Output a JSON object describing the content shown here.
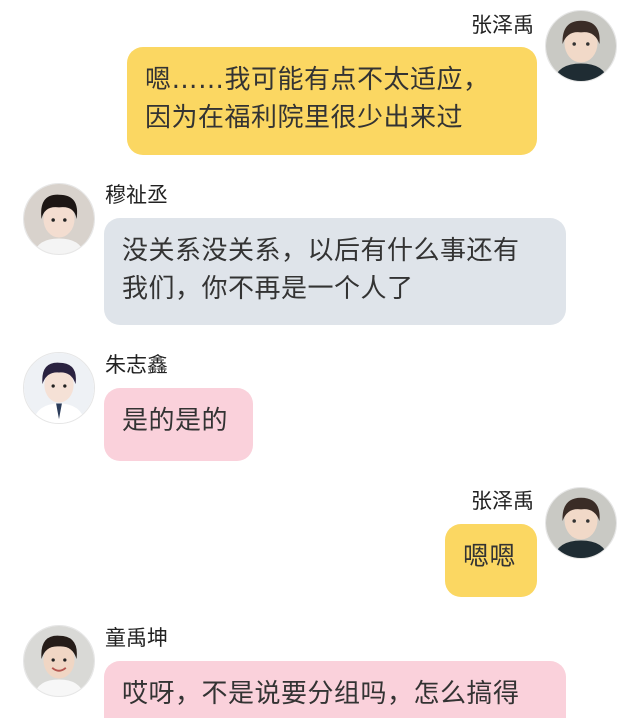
{
  "colors": {
    "self_bubble": "#fbd762",
    "grey_bubble": "#dfe4ea",
    "pink_bubble": "#fad1db",
    "name_text": "#222222",
    "message_text": "#333333"
  },
  "messages": [
    {
      "sender": "张泽禹",
      "side": "right",
      "avatar_icon": "boy-avatar-dark-shirt-icon",
      "lines": [
        "嗯……我可能有点不太适应，",
        "因为在福利院里很少出来过"
      ]
    },
    {
      "sender": "穆祉丞",
      "side": "left",
      "avatar_icon": "boy-avatar-icon",
      "lines": [
        "没关系没关系，以后有什么事还有",
        "我们，你不再是一个人了"
      ]
    },
    {
      "sender": "朱志鑫",
      "side": "left",
      "avatar_icon": "boy-avatar-white-shirt-icon",
      "lines": [
        "是的是的"
      ]
    },
    {
      "sender": "张泽禹",
      "side": "right",
      "avatar_icon": "boy-avatar-dark-shirt-icon",
      "lines": [
        "嗯嗯"
      ]
    },
    {
      "sender": "童禹坤",
      "side": "left",
      "avatar_icon": "boy-avatar-smiling-icon",
      "lines": [
        "哎呀，不是说要分组吗，怎么搞得"
      ]
    }
  ]
}
